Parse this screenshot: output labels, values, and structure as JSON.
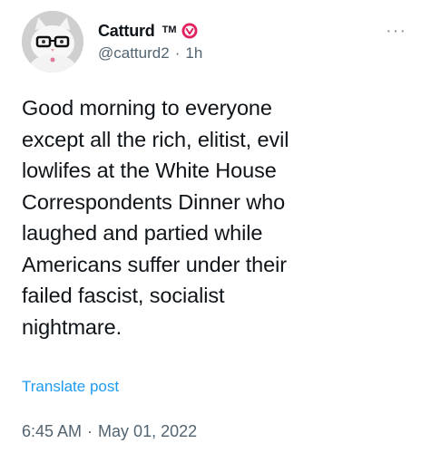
{
  "author": {
    "display_name": "Catturd",
    "tm": "TM",
    "handle": "@catturd2",
    "age": "1h",
    "separator": "·"
  },
  "icons": {
    "verified": "verified-badge-icon",
    "more": "more-options-icon",
    "avatar": "cat-with-glasses-avatar"
  },
  "post": {
    "text": "Good morning to everyone\nexcept all the rich, elitist, evil\nlowlifes at the White House\nCorrespondents Dinner who\nlaughed and partied while\nAmericans suffer under their\nfailed fascist, socialist\nnightmare.",
    "translate_label": "Translate post",
    "time": "6:45 AM",
    "separator": "·",
    "date": "May 01, 2022"
  },
  "colors": {
    "text": "#0f1419",
    "secondary": "#536471",
    "link": "#1d9bf0",
    "verified_badge": "#e0245e"
  }
}
